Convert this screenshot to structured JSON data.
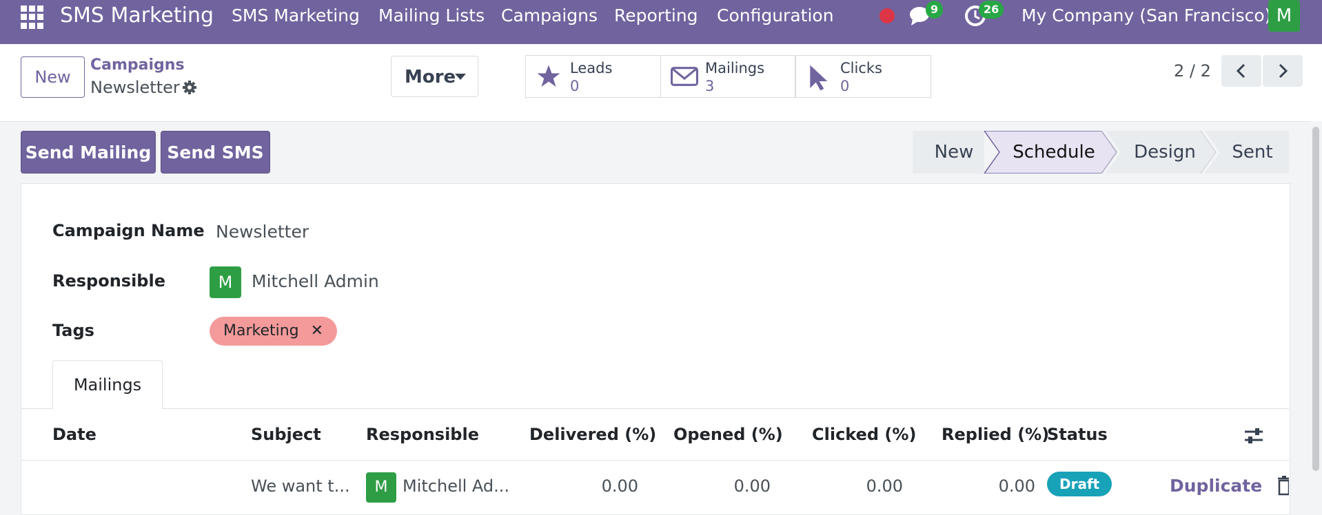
{
  "topbar": {
    "app_title": "SMS Marketing",
    "menu": [
      "SMS Marketing",
      "Mailing Lists",
      "Campaigns",
      "Reporting",
      "Configuration"
    ],
    "messages_count": "9",
    "activities_count": "26",
    "company": "My Company (San Francisco)",
    "user_initial": "M"
  },
  "control": {
    "new_label": "New",
    "breadcrumb_parent": "Campaigns",
    "breadcrumb_current": "Newsletter",
    "more_label": "More",
    "stats": [
      {
        "label": "Leads",
        "value": "0"
      },
      {
        "label": "Mailings",
        "value": "3"
      },
      {
        "label": "Clicks",
        "value": "0"
      }
    ],
    "pager": "2 / 2"
  },
  "actions": {
    "send_mailing": "Send Mailing",
    "send_sms": "Send SMS"
  },
  "stages": [
    "New",
    "Schedule",
    "Design",
    "Sent"
  ],
  "active_stage": "Schedule",
  "form": {
    "campaign_name_label": "Campaign Name",
    "campaign_name": "Newsletter",
    "responsible_label": "Responsible",
    "responsible_initial": "M",
    "responsible": "Mitchell Admin",
    "tags_label": "Tags",
    "tag": "Marketing",
    "tag_remove": "✕"
  },
  "tab": "Mailings",
  "table": {
    "headers": [
      "Date",
      "Subject",
      "Responsible",
      "Delivered (%)",
      "Opened (%)",
      "Clicked (%)",
      "Replied (%)",
      "Status"
    ],
    "rows": [
      {
        "date": "",
        "subject": "We want t...",
        "responsible_initial": "M",
        "responsible": "Mitchell Ad...",
        "delivered": "0.00",
        "opened": "0.00",
        "clicked": "0.00",
        "replied": "0.00",
        "status": "Draft",
        "action": "Duplicate"
      }
    ]
  },
  "colors": {
    "brand": "#71639e",
    "badge_green": "#28a745",
    "draft_badge": "#17a2b8",
    "tag": "#f49a9a",
    "record_dot": "#dc3545"
  }
}
